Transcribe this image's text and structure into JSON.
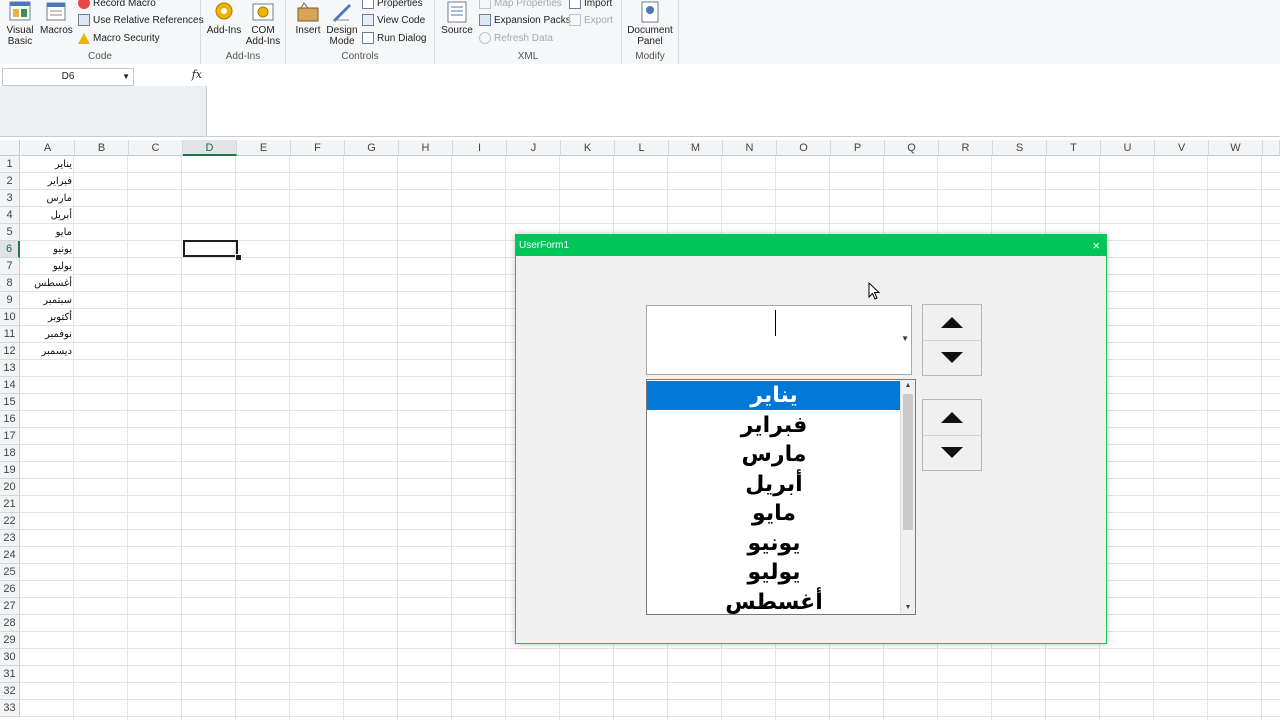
{
  "ribbon": {
    "code": {
      "label": "Code",
      "visual_basic": "Visual Basic",
      "macros": "Macros",
      "record_macro": "Record Macro",
      "use_relative": "Use Relative References",
      "macro_security": "Macro Security"
    },
    "addins": {
      "label": "Add-Ins",
      "addins": "Add-Ins",
      "com_addins": "COM Add-Ins"
    },
    "controls": {
      "label": "Controls",
      "insert": "Insert",
      "design_mode": "Design Mode",
      "properties": "Properties",
      "view_code": "View Code",
      "run_dialog": "Run Dialog"
    },
    "xml": {
      "label": "XML",
      "source": "Source",
      "map_properties": "Map Properties",
      "expansion_packs": "Expansion Packs",
      "refresh_data": "Refresh Data",
      "import": "Import",
      "export": "Export"
    },
    "modify": {
      "label": "Modify",
      "document_panel": "Document Panel"
    }
  },
  "formula_bar": {
    "name_box": "D6",
    "fx": "fx",
    "formula": ""
  },
  "sheet": {
    "columns": [
      "A",
      "B",
      "C",
      "D",
      "E",
      "F",
      "G",
      "H",
      "I",
      "J",
      "K",
      "L",
      "M",
      "N",
      "O",
      "P",
      "Q",
      "R",
      "S",
      "T",
      "U",
      "V",
      "W"
    ],
    "selected_column": "D",
    "selected_row": 6,
    "rows": [
      "1",
      "2",
      "3",
      "4",
      "5",
      "6",
      "7",
      "8",
      "9",
      "10",
      "11",
      "12",
      "13",
      "14",
      "15",
      "16",
      "17",
      "18",
      "19",
      "20",
      "21",
      "22",
      "23",
      "24",
      "25",
      "26",
      "27",
      "28",
      "29",
      "30",
      "31",
      "32",
      "33"
    ],
    "col_a_values": [
      "يناير",
      "فبراير",
      "مارس",
      "أبريل",
      "مايو",
      "يونيو",
      "يوليو",
      "أغسطس",
      "سبتمبر",
      "أكتوبر",
      "نوفمبر",
      "ديسمبر"
    ]
  },
  "userform": {
    "title": "UserForm1",
    "close": "×",
    "combo_value": "",
    "list_items": [
      "يناير",
      "فبراير",
      "مارس",
      "أبريل",
      "مايو",
      "يونيو",
      "يوليو",
      "أغسطس"
    ],
    "selected_index": 0
  },
  "colors": {
    "titlebar": "#00c65a",
    "selection": "#0078d7",
    "excel_green": "#217346"
  }
}
